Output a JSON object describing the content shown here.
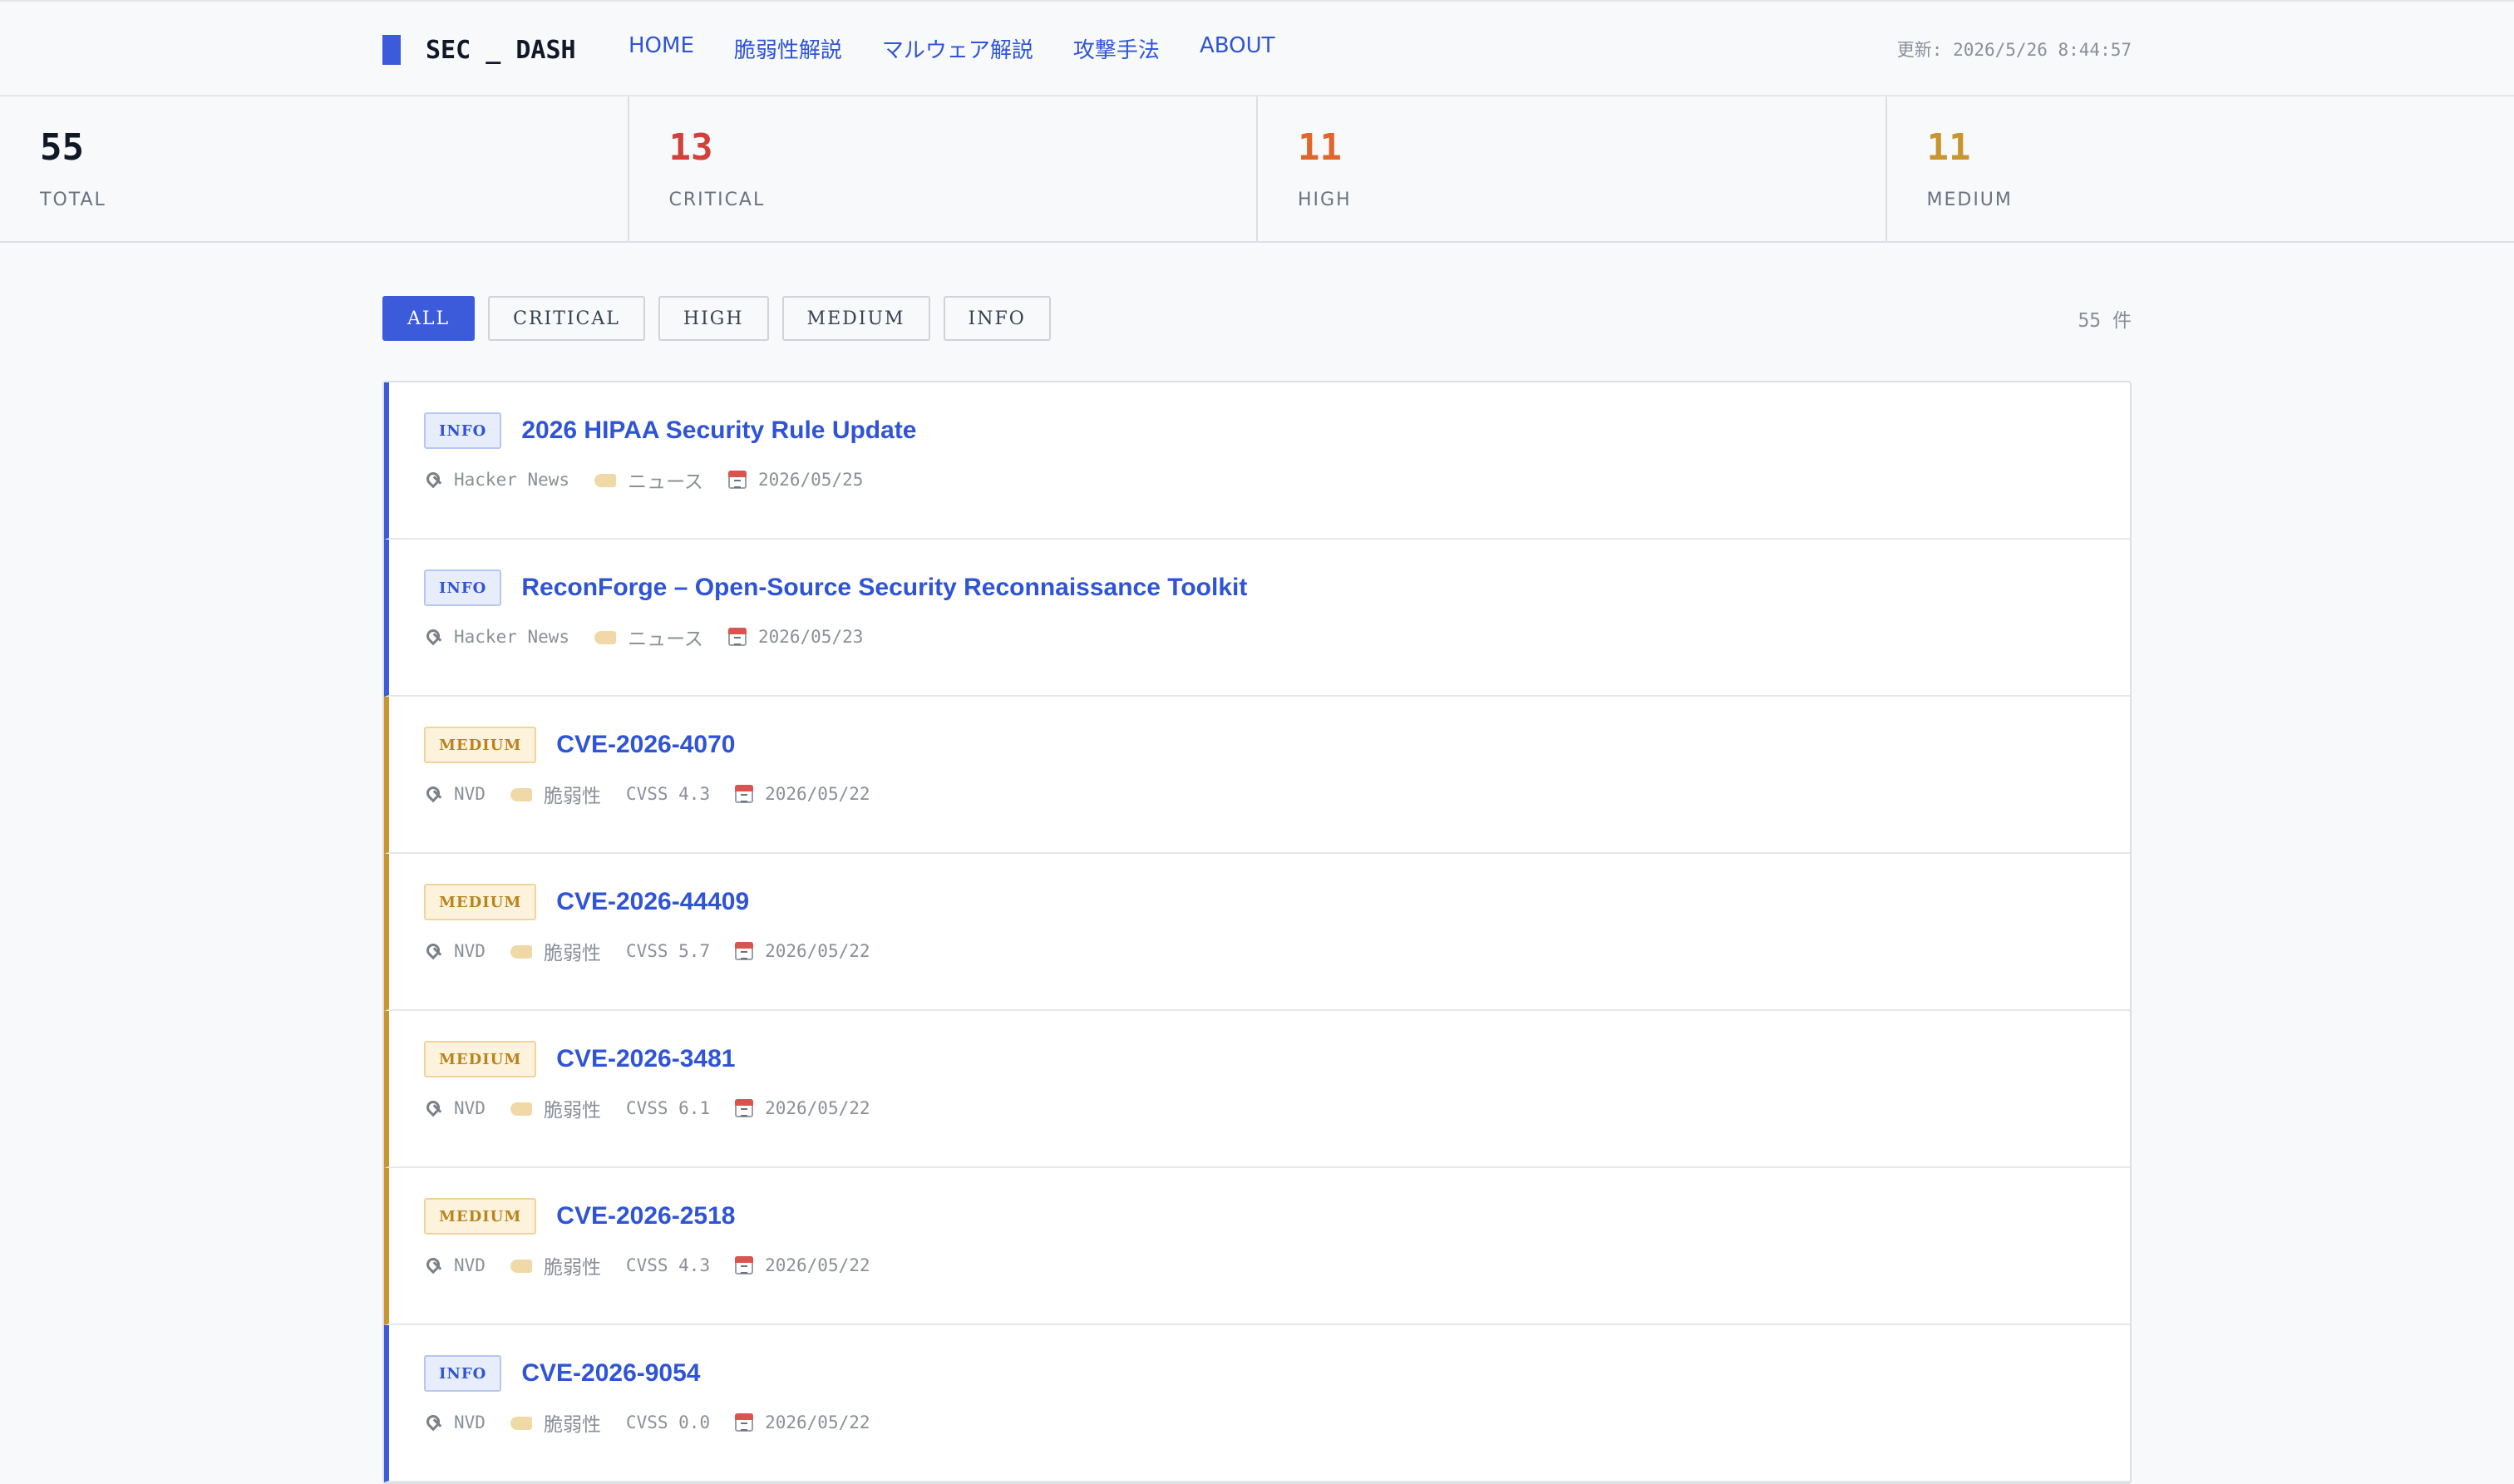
{
  "header": {
    "brand": "SEC _ DASH",
    "nav": [
      "HOME",
      "脆弱性解説",
      "マルウェア解説",
      "攻撃手法",
      "ABOUT"
    ],
    "updated": "更新: 2026/5/26 8:44:57"
  },
  "stats": [
    {
      "value": "55",
      "label": "TOTAL",
      "color": "#111827"
    },
    {
      "value": "13",
      "label": "CRITICAL",
      "color": "#d2403a"
    },
    {
      "value": "11",
      "label": "HIGH",
      "color": "#e0662b"
    },
    {
      "value": "11",
      "label": "MEDIUM",
      "color": "#c9952f"
    }
  ],
  "filters": {
    "buttons": [
      "ALL",
      "CRITICAL",
      "HIGH",
      "MEDIUM",
      "INFO"
    ],
    "active": "ALL",
    "count": "55 件"
  },
  "colors": {
    "accent": "#3b5bdb",
    "info": "#3b5bdb",
    "medium": "#c9952f",
    "critical": "#d2403a",
    "high": "#e0662b"
  },
  "items": [
    {
      "severity": "INFO",
      "title": "2026 HIPAA Security Rule Update",
      "source": "Hacker News",
      "category": "ニュース",
      "cvss": "",
      "date": "2026/05/25"
    },
    {
      "severity": "INFO",
      "title": "ReconForge – Open-Source Security Reconnaissance Toolkit",
      "source": "Hacker News",
      "category": "ニュース",
      "cvss": "",
      "date": "2026/05/23"
    },
    {
      "severity": "MEDIUM",
      "title": "CVE-2026-4070",
      "source": "NVD",
      "category": "脆弱性",
      "cvss": "CVSS 4.3",
      "date": "2026/05/22"
    },
    {
      "severity": "MEDIUM",
      "title": "CVE-2026-44409",
      "source": "NVD",
      "category": "脆弱性",
      "cvss": "CVSS 5.7",
      "date": "2026/05/22"
    },
    {
      "severity": "MEDIUM",
      "title": "CVE-2026-3481",
      "source": "NVD",
      "category": "脆弱性",
      "cvss": "CVSS 6.1",
      "date": "2026/05/22"
    },
    {
      "severity": "MEDIUM",
      "title": "CVE-2026-2518",
      "source": "NVD",
      "category": "脆弱性",
      "cvss": "CVSS 4.3",
      "date": "2026/05/22"
    },
    {
      "severity": "INFO",
      "title": "CVE-2026-9054",
      "source": "NVD",
      "category": "脆弱性",
      "cvss": "CVSS 0.0",
      "date": "2026/05/22"
    }
  ]
}
